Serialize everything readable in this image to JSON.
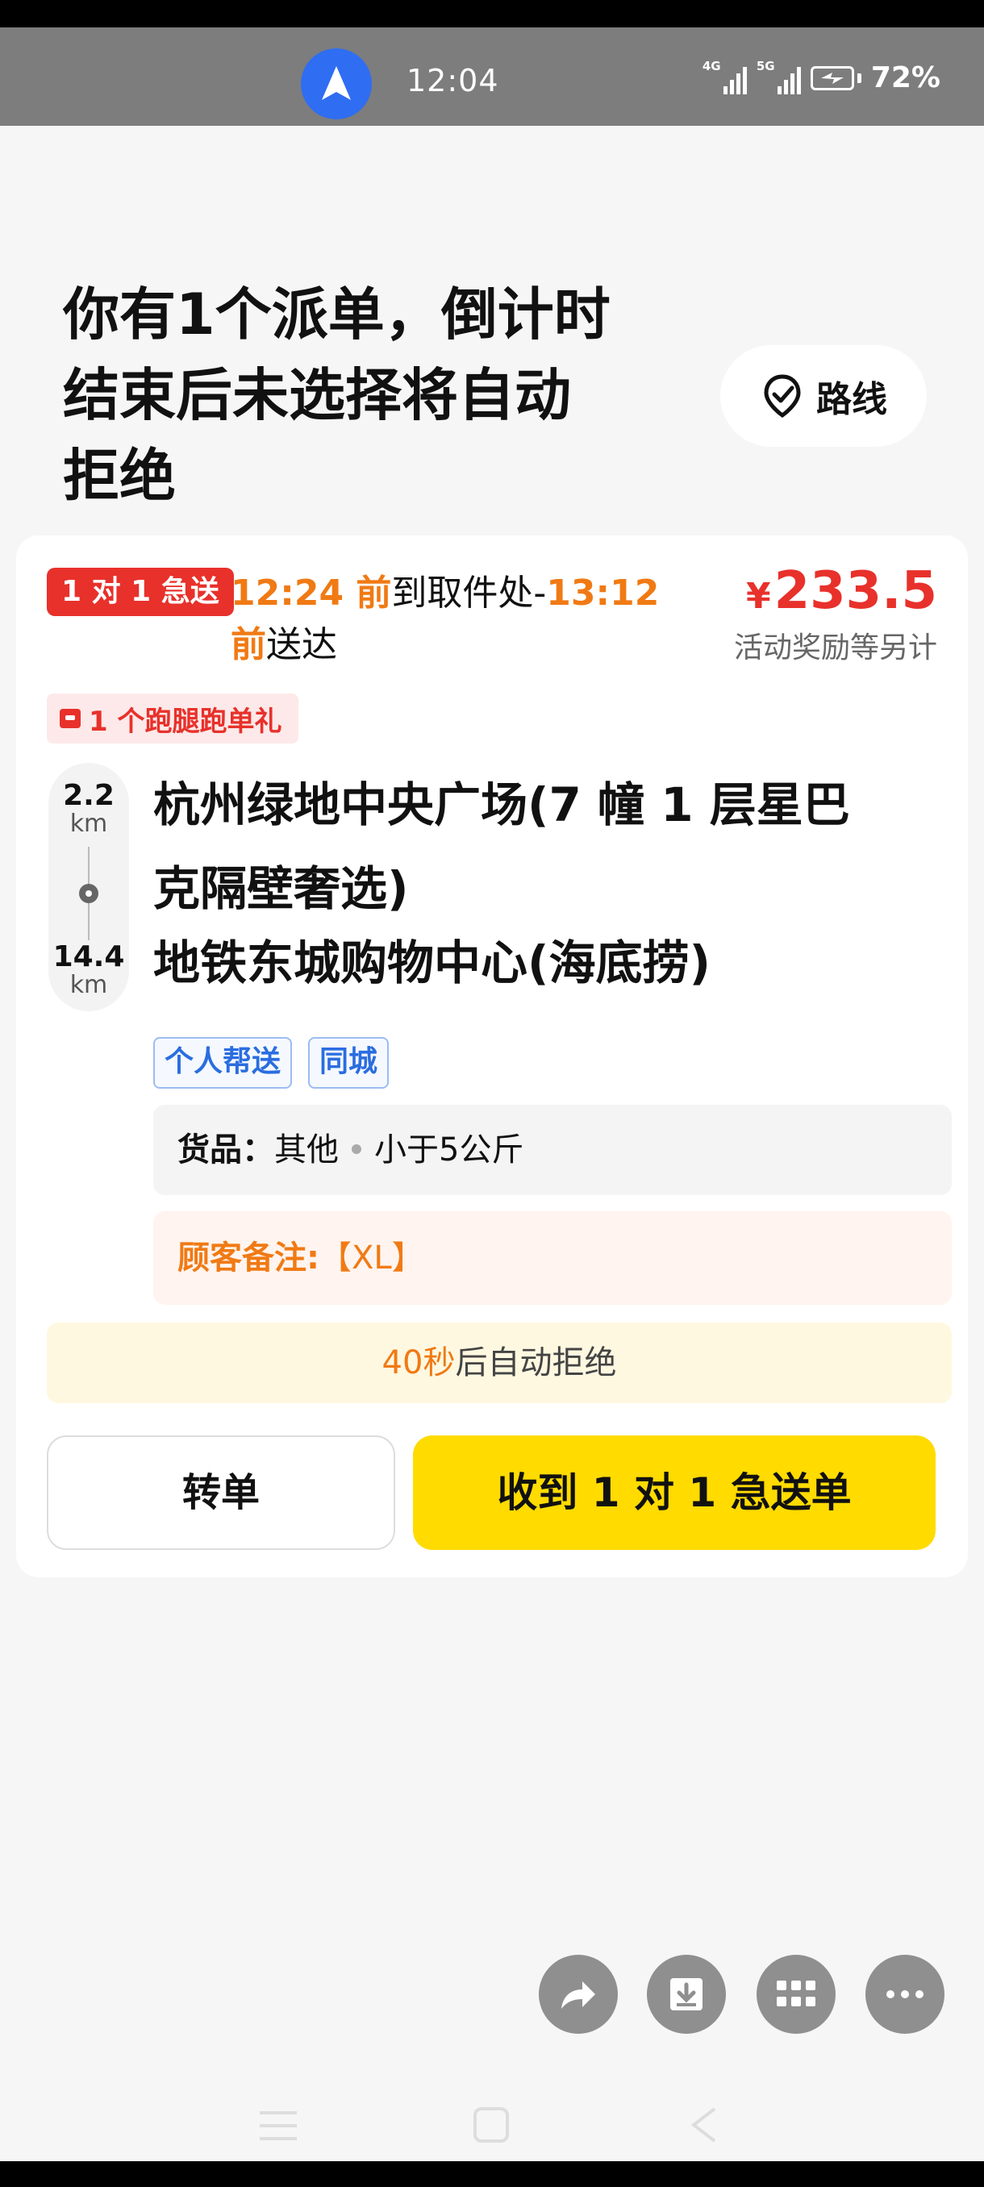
{
  "status_bar": {
    "time": "12:04",
    "sig1": "4G",
    "sig2": "5G",
    "battery": "72%"
  },
  "header": {
    "title_lines": [
      "你有1个派单，倒计时",
      "结束后未选择将自动",
      "拒绝"
    ],
    "route_label": "路线"
  },
  "order": {
    "urgent_tag": "1 对 1 急送",
    "pickup_time": "12:24 前",
    "pickup_text": "到取件处-",
    "deliver_time": "13:12",
    "deliver_time2": "前",
    "deliver_text": "送达",
    "price_symbol": "¥",
    "price": "233.5",
    "price_note": "活动奖励等另计",
    "gift": "1 个跑腿跑单礼",
    "distance_pickup": "2.2",
    "distance_pickup_unit": "km",
    "distance_delivery": "14.4",
    "distance_delivery_unit": "km",
    "pickup_address_lines": [
      "杭州绿地中央广场(7 幢 1 层星巴",
      "克隔壁奢选)"
    ],
    "delivery_address": "地铁东城购物中心(海底捞)",
    "chips": [
      "个人帮送",
      "同城"
    ],
    "goods_label": "货品：",
    "goods_type": "其他",
    "goods_weight": "小于5公斤",
    "remark_label": "顾客备注:",
    "remark_value": "【XL】",
    "countdown_seconds": "40秒",
    "countdown_text": "后自动拒绝",
    "transfer_label": "转单",
    "accept_label": "收到 1 对 1 急送单"
  },
  "floating_actions": [
    "share-icon",
    "download-icon",
    "apps-grid-icon",
    "more-icon"
  ],
  "colors": {
    "accent_red": "#e8312b",
    "accent_orange": "#f07a14",
    "accent_yellow": "#ffdb00",
    "chip_blue": "#2b6de0"
  }
}
